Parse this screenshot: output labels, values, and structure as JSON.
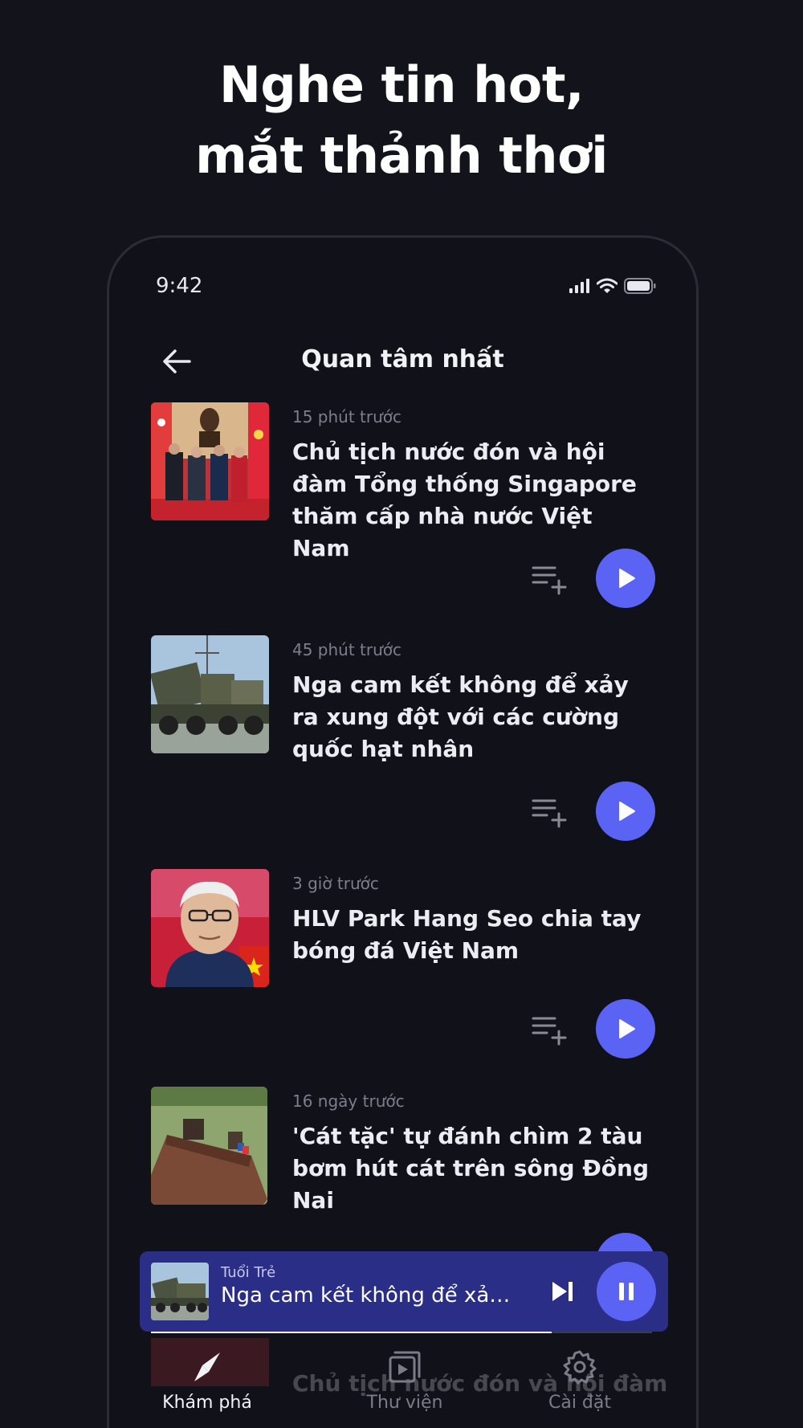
{
  "headline": {
    "line1": "Nghe tin hot,",
    "line2": "mắt thảnh thơi"
  },
  "status_bar": {
    "time": "9:42",
    "icons": [
      "signal-icon",
      "wifi-icon",
      "battery-icon"
    ]
  },
  "nav": {
    "back_icon": "arrow-left-icon",
    "title": "Quan tâm nhất"
  },
  "articles": [
    {
      "time_ago": "15 phút trước",
      "title": "Chủ tịch nước đón và hội đàm Tổng thống Singapore thăm cấp nhà nước Việt Nam"
    },
    {
      "time_ago": "45 phút trước",
      "title": "Nga cam kết không để xảy ra xung đột với các cường quốc hạt nhân"
    },
    {
      "time_ago": "3 giờ trước",
      "title": "HLV Park Hang Seo chia tay bóng đá Việt Nam"
    },
    {
      "time_ago": "16 ngày trước",
      "title": "'Cát tặc' tự đánh chìm 2 tàu bơm hút cát trên sông Đồng Nai"
    }
  ],
  "mini_player": {
    "source": "Tuổi Trẻ",
    "title": "Nga cam kết không để xảy ra xung đột với các cường quốc hạt nhân",
    "progress": 0.8
  },
  "ghost_item": {
    "title": "Chủ tịch nước đón và hội đàm"
  },
  "tabs": [
    {
      "label": "Khám phá",
      "icon": "compass-icon",
      "active": true
    },
    {
      "label": "Thư viện",
      "icon": "library-icon",
      "active": false
    },
    {
      "label": "Cài đặt",
      "icon": "gear-icon",
      "active": false
    }
  ],
  "colors": {
    "background": "#13131c",
    "accent": "#5b63f5",
    "mini_player_bg": "#2b2e86"
  }
}
